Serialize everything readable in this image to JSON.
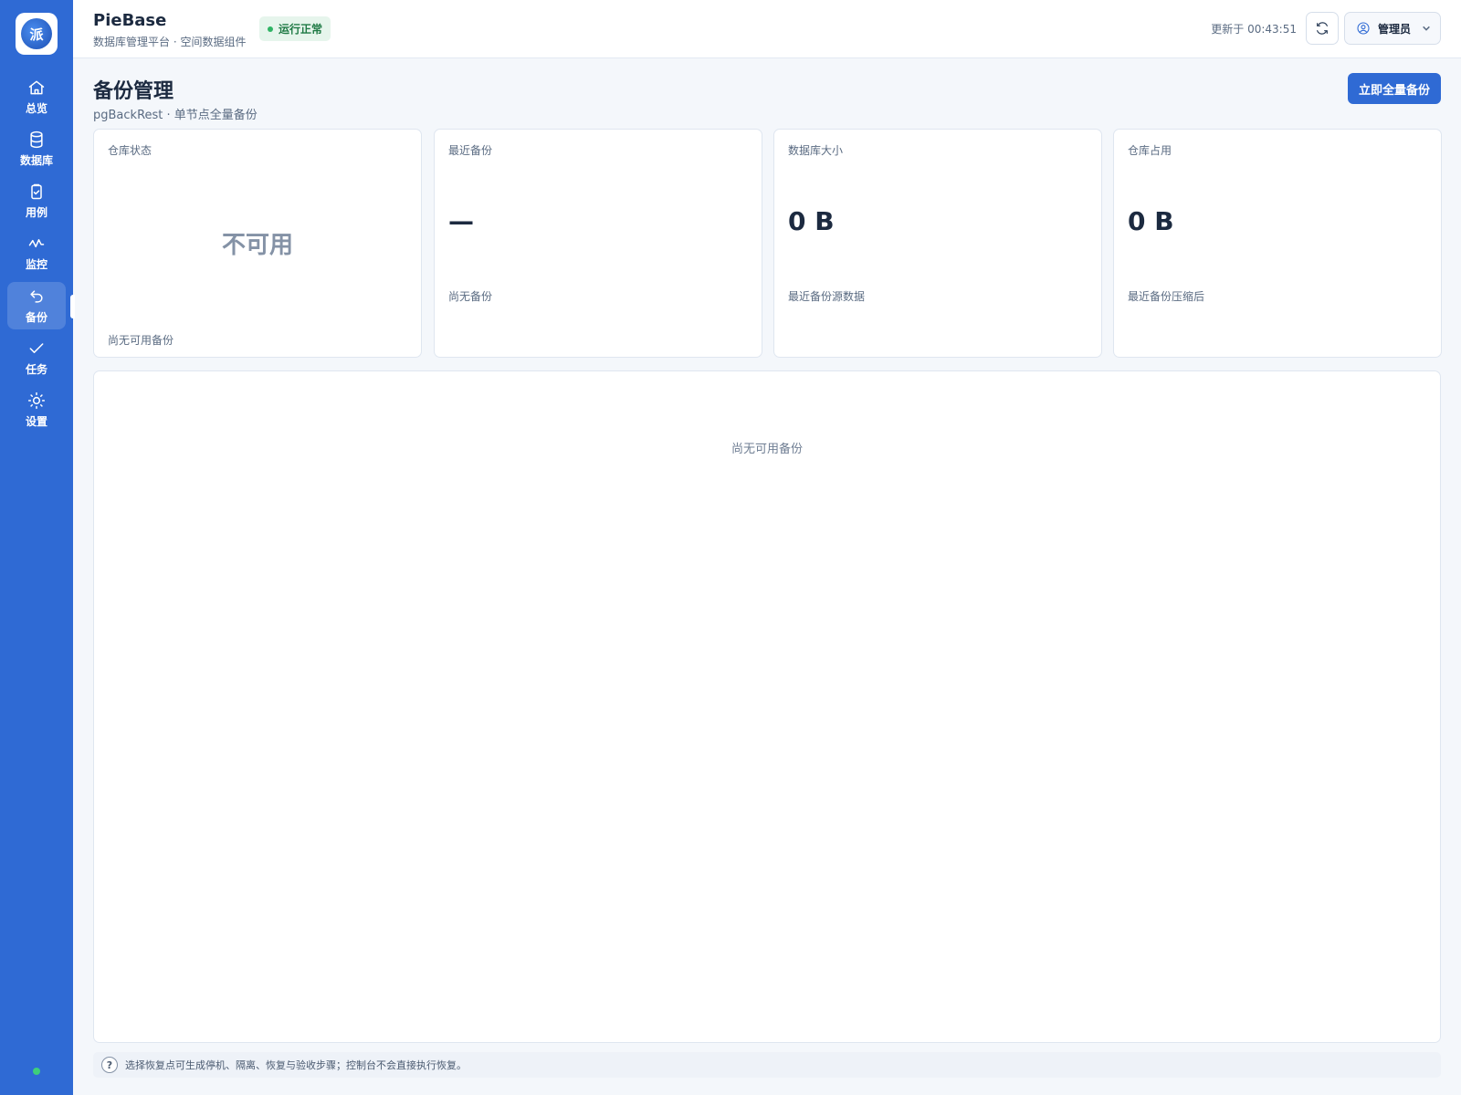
{
  "sidebar": {
    "logo_glyph": "派",
    "items": [
      {
        "label": "总览",
        "icon": "home-icon"
      },
      {
        "label": "数据库",
        "icon": "database-icon"
      },
      {
        "label": "用例",
        "icon": "clipboard-icon"
      },
      {
        "label": "监控",
        "icon": "activity-icon"
      },
      {
        "label": "备份",
        "icon": "undo-icon",
        "active": true
      },
      {
        "label": "任务",
        "icon": "check-icon"
      },
      {
        "label": "设置",
        "icon": "sun-gear-icon"
      }
    ],
    "status_color": "#3ecf7a"
  },
  "header": {
    "app_title": "PieBase",
    "app_subtitle": "数据库管理平台 · 空间数据组件",
    "status_badge": "运行正常",
    "updated_text": "更新于 00:43:51",
    "user_name": "管理员"
  },
  "page": {
    "title": "备份管理",
    "subtitle": "pgBackRest · 单节点全量备份",
    "primary_action": "立即全量备份"
  },
  "cards": [
    {
      "label": "仓库状态",
      "value": "不可用",
      "note": "尚无可用备份"
    },
    {
      "label": "最近备份",
      "value": "—",
      "note": "尚无备份"
    },
    {
      "label": "数据库大小",
      "value": "0 B",
      "note": "最近备份源数据"
    },
    {
      "label": "仓库占用",
      "value": "0 B",
      "note": "最近备份压缩后"
    }
  ],
  "panel": {
    "empty_text": "尚无可用备份"
  },
  "footer": {
    "help_glyph": "?",
    "hint": "选择恢复点可生成停机、隔离、恢复与验收步骤；控制台不会直接执行恢复。"
  },
  "colors": {
    "sidebar": "#2f6ad4",
    "primary": "#2f6ad4",
    "status_ok": "#2fb464"
  }
}
